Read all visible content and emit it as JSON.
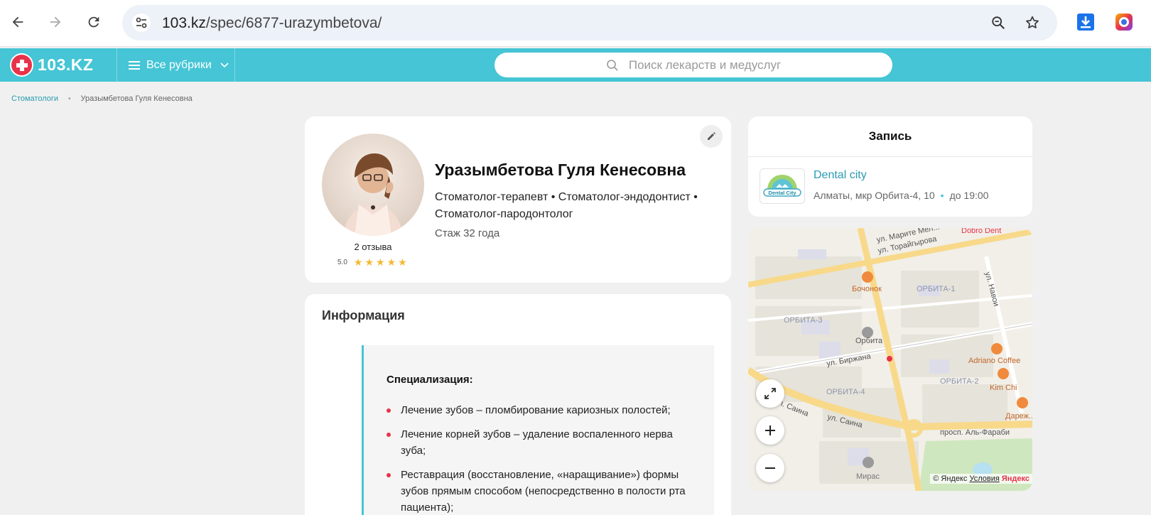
{
  "browser": {
    "url_host": "103.kz",
    "url_path": "/spec/6877-urazymbetova/"
  },
  "header": {
    "logo_text": "103.KZ",
    "rubrics_label": "Все рубрики",
    "search_placeholder": "Поиск лекарств и медуслуг"
  },
  "breadcrumb": {
    "parent": "Стоматологи",
    "current": "Уразымбетова Гуля Кенесовна"
  },
  "profile": {
    "name": "Уразымбетова Гуля Кенесовна",
    "specialties": "Стоматолог-терапевт • Стоматолог-эндодонтист • Стоматолог-пародонтолог",
    "experience": "Стаж 32 года",
    "reviews": "2 отзыва",
    "rating": "5.0",
    "stars": 5
  },
  "info": {
    "title": "Информация",
    "heading": "Специализация:",
    "items": [
      "Лечение зубов – пломбирование кариозных полостей;",
      "Лечение корней зубов – удаление воспаленного нерва зуба;",
      "Реставрация (восстановление, «наращивание») формы зубов прямым способом (непосредственно в полости рта пациента);"
    ]
  },
  "booking": {
    "title": "Запись",
    "clinic_name": "Dental city",
    "clinic_address": "Алматы, мкр Орбита-4, 10",
    "clinic_hours": "до 19:00",
    "clinic_logo_text": "Dental City"
  },
  "map": {
    "labels": {
      "street_marite": "ул. Марите Мел...",
      "street_toraigyrova": "ул. Торайгырова",
      "dobro_dent": "Dobro Dent",
      "bochonok": "Бочонок",
      "orbita1": "ОРБИТА-1",
      "street_navoi": "ул. Навои",
      "orbita3": "ОРБИТА-3",
      "orbita": "Орбита",
      "adriano": "Adriano Coffee",
      "street_birzhana": "ул. Биржана",
      "orbita2": "ОРБИТА-2",
      "kimchi": "Kim Chi",
      "orbita4": "ОРБИТА-4",
      "darezh": "Дареж...",
      "street_saina1": "ул. Саина",
      "street_saina2": "ул. Саина",
      "al_farabi": "просп. Аль-Фараби",
      "miras": "Мирас"
    },
    "copyright": "© Яндекс",
    "terms": "Условия",
    "brand": "Яндекс"
  }
}
